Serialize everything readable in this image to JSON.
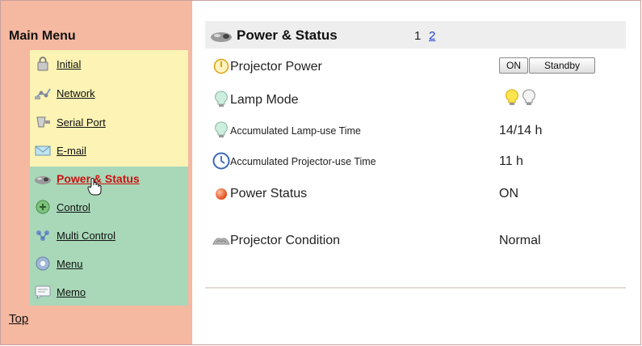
{
  "sidebar": {
    "title": "Main Menu",
    "items": [
      {
        "label": "Initial",
        "icon": "lock-icon"
      },
      {
        "label": "Network",
        "icon": "network-icon"
      },
      {
        "label": "Serial Port",
        "icon": "serial-port-icon"
      },
      {
        "label": "E-mail",
        "icon": "email-icon"
      },
      {
        "label": "Power & Status",
        "icon": "projector-icon",
        "active": true
      },
      {
        "label": "Control",
        "icon": "control-icon"
      },
      {
        "label": "Multi Control",
        "icon": "multi-control-icon"
      },
      {
        "label": "Menu",
        "icon": "menu-icon"
      },
      {
        "label": "Memo",
        "icon": "memo-icon"
      }
    ],
    "top_link": "Top"
  },
  "main": {
    "title": "Power & Status",
    "pages": [
      "1",
      "2"
    ],
    "rows": {
      "projector_power": {
        "label": "Projector Power",
        "buttons": [
          "ON",
          "Standby"
        ]
      },
      "lamp_mode": {
        "label": "Lamp Mode"
      },
      "lamp_time": {
        "label": "Accumulated Lamp-use Time",
        "value": "14/14 h"
      },
      "projector_time": {
        "label": "Accumulated Projector-use Time",
        "value": "11 h"
      },
      "power_status": {
        "label": "Power Status",
        "value": "ON"
      },
      "condition": {
        "label": "Projector Condition",
        "value": "Normal"
      }
    }
  },
  "colors": {
    "sidebar_bg": "#f5b8a0",
    "group_yellow": "#fcf3b4",
    "group_green": "#a8d8b8",
    "active_link": "#cc1111",
    "page_link": "#2244cc"
  }
}
